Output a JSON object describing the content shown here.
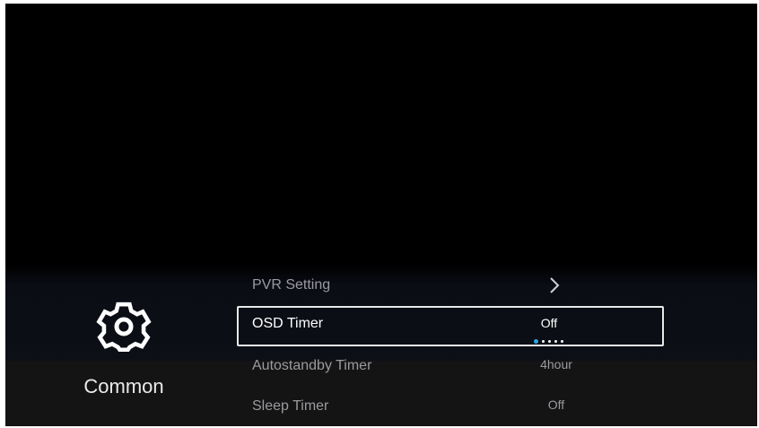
{
  "category": {
    "label": "Common",
    "icon": "gear-icon"
  },
  "menu": {
    "items": [
      {
        "label": "PVR Setting",
        "value": "",
        "type": "submenu",
        "icon": "chevron-right-icon"
      },
      {
        "label": "OSD Timer",
        "value": "Off",
        "type": "selector",
        "focused": true,
        "option_count": 5,
        "selected_option_index": 0
      },
      {
        "label": "Autostandby Timer",
        "value": "4hour",
        "type": "selector"
      },
      {
        "label": "Sleep Timer",
        "value": "Off",
        "type": "selector"
      }
    ]
  },
  "colors": {
    "focus_border": "#e8e8e8",
    "accent": "#2aa8e0",
    "text_primary": "#ffffff",
    "text_secondary": "#9a9aa0"
  }
}
